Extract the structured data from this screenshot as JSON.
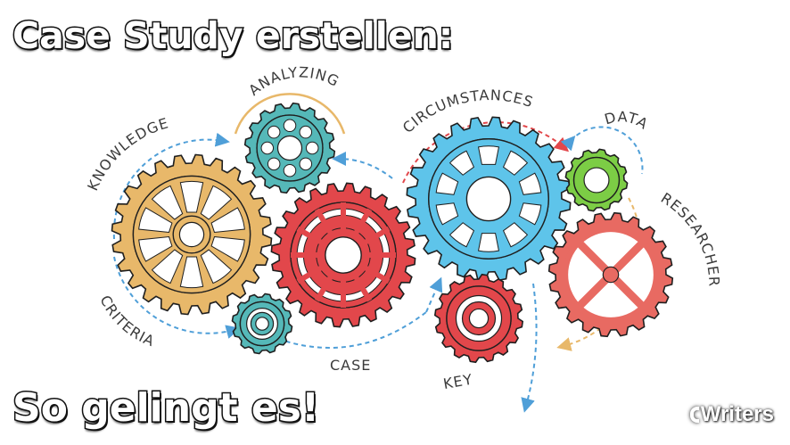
{
  "headline": {
    "top": "Case Study erstellen:",
    "bottom": "So gelingt es!"
  },
  "brand": "Writers",
  "gear_labels": {
    "knowledge": "KNOWLEDGE",
    "analyzing": "ANALYZING",
    "circumstances": "CIRCUMSTANCES",
    "data": "DATA",
    "researcher": "RESEARCHER",
    "criteria": "CRITERIA",
    "case": "CASE",
    "key": "KEY"
  },
  "colors": {
    "orange": "#e8b86a",
    "teal": "#55b8b8",
    "red": "#e2474b",
    "blue": "#5ec4ea",
    "green": "#7ccd45",
    "coral": "#e86a62",
    "dashed_blue": "#4f9fd8",
    "dashed_red": "#e2474b",
    "dashed_orange": "#e8b86a",
    "outline": "#1f1f1f"
  }
}
